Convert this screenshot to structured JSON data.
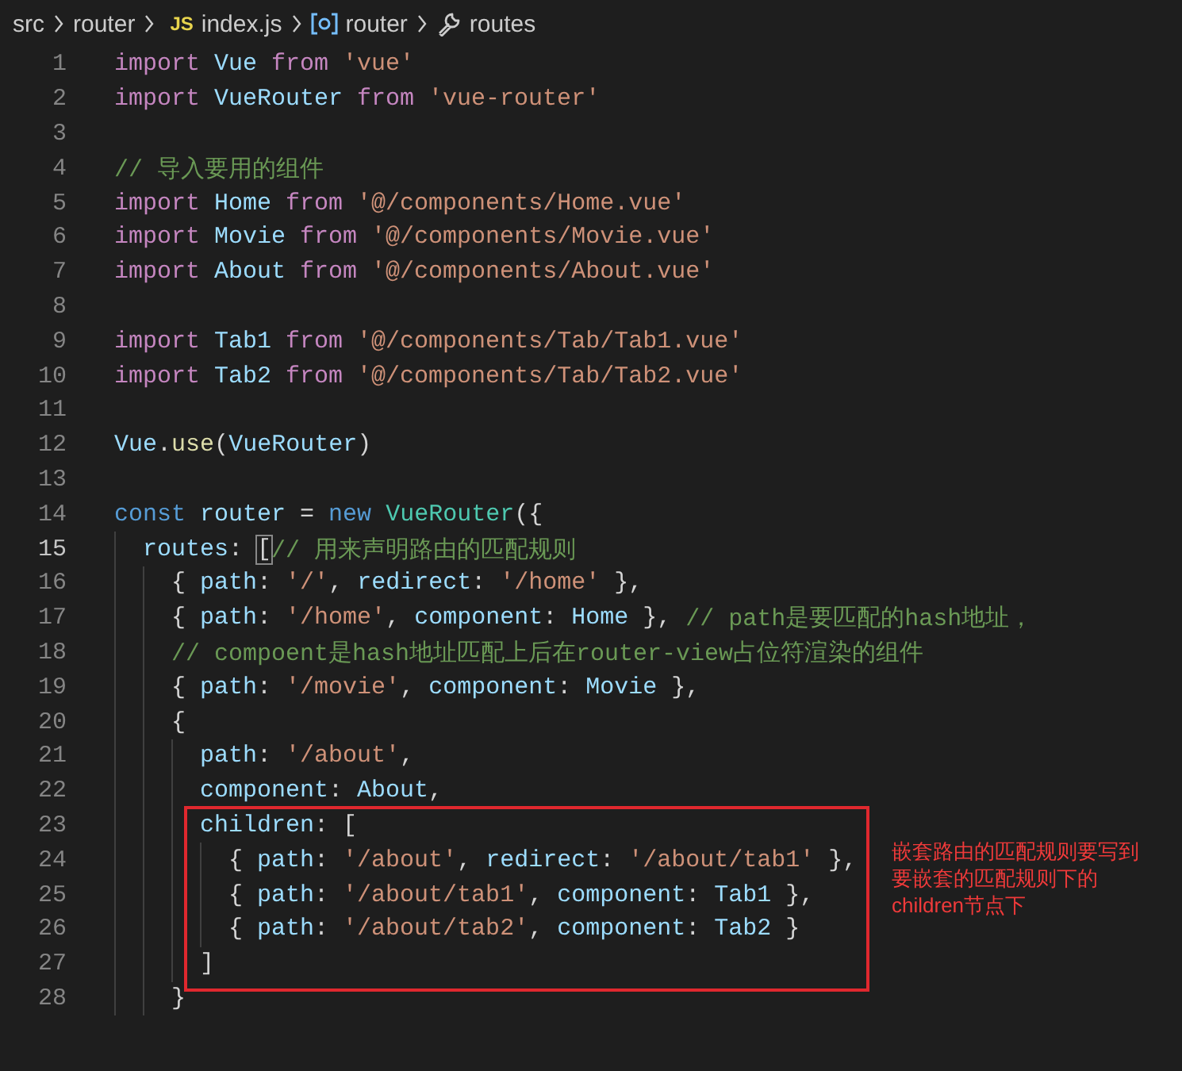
{
  "breadcrumb": [
    {
      "kind": "folder",
      "label": "src"
    },
    {
      "kind": "folder",
      "label": "router"
    },
    {
      "kind": "file",
      "label": "index.js",
      "badge": "JS"
    },
    {
      "kind": "variable",
      "label": "router"
    },
    {
      "kind": "property",
      "label": "routes"
    }
  ],
  "editor": {
    "lines": [
      {
        "number": "1",
        "active": false,
        "boxed": false,
        "tokens": [
          {
            "kind": "keyword",
            "text": "import"
          },
          {
            "kind": "variable",
            "text": " Vue"
          },
          {
            "kind": "keyword",
            "text": " from"
          },
          {
            "kind": "string",
            "text": " 'vue'"
          }
        ]
      },
      {
        "number": "2",
        "active": false,
        "boxed": false,
        "tokens": [
          {
            "kind": "keyword",
            "text": "import"
          },
          {
            "kind": "variable",
            "text": " VueRouter"
          },
          {
            "kind": "keyword",
            "text": " from"
          },
          {
            "kind": "string",
            "text": " 'vue-router'"
          }
        ]
      },
      {
        "number": "3",
        "active": false,
        "boxed": false
      },
      {
        "number": "4",
        "active": false,
        "boxed": false,
        "tokens": [
          {
            "kind": "comment",
            "text": "// 导入要用的组件"
          }
        ]
      },
      {
        "number": "5",
        "active": false,
        "boxed": false,
        "tokens": [
          {
            "kind": "keyword",
            "text": "import"
          },
          {
            "kind": "variable",
            "text": " Home"
          },
          {
            "kind": "keyword",
            "text": " from"
          },
          {
            "kind": "string",
            "text": " '@/components/Home.vue'"
          }
        ]
      },
      {
        "number": "6",
        "active": false,
        "boxed": false,
        "tokens": [
          {
            "kind": "keyword",
            "text": "import"
          },
          {
            "kind": "variable",
            "text": " Movie"
          },
          {
            "kind": "keyword",
            "text": " from"
          },
          {
            "kind": "string",
            "text": " '@/components/Movie.vue'"
          }
        ]
      },
      {
        "number": "7",
        "active": false,
        "boxed": false,
        "tokens": [
          {
            "kind": "keyword",
            "text": "import"
          },
          {
            "kind": "variable",
            "text": " About"
          },
          {
            "kind": "keyword",
            "text": " from"
          },
          {
            "kind": "string",
            "text": " '@/components/About.vue'"
          }
        ]
      },
      {
        "number": "8",
        "active": false,
        "boxed": false
      },
      {
        "number": "9",
        "active": false,
        "boxed": false,
        "tokens": [
          {
            "kind": "keyword",
            "text": "import"
          },
          {
            "kind": "variable",
            "text": " Tab1"
          },
          {
            "kind": "keyword",
            "text": " from"
          },
          {
            "kind": "string",
            "text": " '@/components/Tab/Tab1.vue'"
          }
        ]
      },
      {
        "number": "10",
        "active": false,
        "boxed": false,
        "tokens": [
          {
            "kind": "keyword",
            "text": "import"
          },
          {
            "kind": "variable",
            "text": " Tab2"
          },
          {
            "kind": "keyword",
            "text": " from"
          },
          {
            "kind": "string",
            "text": " '@/components/Tab/Tab2.vue'"
          }
        ]
      },
      {
        "number": "11",
        "active": false,
        "boxed": false
      },
      {
        "number": "12",
        "active": false,
        "boxed": false,
        "tokens": [
          {
            "kind": "variable",
            "text": "Vue"
          },
          {
            "kind": "plain",
            "text": "."
          },
          {
            "kind": "function",
            "text": "use"
          },
          {
            "kind": "plain",
            "text": "("
          },
          {
            "kind": "variable",
            "text": "VueRouter"
          },
          {
            "kind": "plain",
            "text": ")"
          }
        ]
      },
      {
        "number": "13",
        "active": false,
        "boxed": false
      },
      {
        "number": "14",
        "active": false,
        "boxed": false,
        "tokens": [
          {
            "kind": "storage",
            "text": "const"
          },
          {
            "kind": "variable",
            "text": " router"
          },
          {
            "kind": "plain",
            "text": " ="
          },
          {
            "kind": "storage",
            "text": " new"
          },
          {
            "kind": "class",
            "text": " VueRouter"
          },
          {
            "kind": "plain",
            "text": "({"
          }
        ],
        "children": [
          {
            "number": "15",
            "active": true,
            "boxed": false,
            "tokens": [
              {
                "kind": "variable",
                "text": "routes"
              },
              {
                "kind": "plain",
                "text": ": "
              },
              {
                "kind": "match",
                "text": "["
              },
              {
                "kind": "comment",
                "text": "// 用来声明路由的匹配规则"
              }
            ],
            "children": [
              {
                "number": "16",
                "active": false,
                "boxed": false,
                "tokens": [
                  {
                    "kind": "plain",
                    "text": "{ "
                  },
                  {
                    "kind": "variable",
                    "text": "path"
                  },
                  {
                    "kind": "plain",
                    "text": ": "
                  },
                  {
                    "kind": "string",
                    "text": "'/'"
                  },
                  {
                    "kind": "plain",
                    "text": ", "
                  },
                  {
                    "kind": "variable",
                    "text": "redirect"
                  },
                  {
                    "kind": "plain",
                    "text": ": "
                  },
                  {
                    "kind": "string",
                    "text": "'/home'"
                  },
                  {
                    "kind": "plain",
                    "text": " },"
                  }
                ]
              },
              {
                "number": "17",
                "active": false,
                "boxed": false,
                "tokens": [
                  {
                    "kind": "plain",
                    "text": "{ "
                  },
                  {
                    "kind": "variable",
                    "text": "path"
                  },
                  {
                    "kind": "plain",
                    "text": ": "
                  },
                  {
                    "kind": "string",
                    "text": "'/home'"
                  },
                  {
                    "kind": "plain",
                    "text": ", "
                  },
                  {
                    "kind": "variable",
                    "text": "component"
                  },
                  {
                    "kind": "plain",
                    "text": ": "
                  },
                  {
                    "kind": "variable",
                    "text": "Home"
                  },
                  {
                    "kind": "plain",
                    "text": " }, "
                  },
                  {
                    "kind": "comment",
                    "text": "// path是要匹配的hash地址，"
                  }
                ]
              },
              {
                "number": "18",
                "active": false,
                "boxed": false,
                "tokens": [
                  {
                    "kind": "comment",
                    "text": "// compoent是hash地址匹配上后在router-view占位符渲染的组件"
                  }
                ]
              },
              {
                "number": "19",
                "active": false,
                "boxed": false,
                "tokens": [
                  {
                    "kind": "plain",
                    "text": "{ "
                  },
                  {
                    "kind": "variable",
                    "text": "path"
                  },
                  {
                    "kind": "plain",
                    "text": ": "
                  },
                  {
                    "kind": "string",
                    "text": "'/movie'"
                  },
                  {
                    "kind": "plain",
                    "text": ", "
                  },
                  {
                    "kind": "variable",
                    "text": "component"
                  },
                  {
                    "kind": "plain",
                    "text": ": "
                  },
                  {
                    "kind": "variable",
                    "text": "Movie"
                  },
                  {
                    "kind": "plain",
                    "text": " },"
                  }
                ]
              },
              {
                "number": "20",
                "active": false,
                "boxed": false,
                "tokens": [
                  {
                    "kind": "plain",
                    "text": "{"
                  }
                ],
                "children": [
                  {
                    "number": "21",
                    "active": false,
                    "boxed": false,
                    "tokens": [
                      {
                        "kind": "variable",
                        "text": "path"
                      },
                      {
                        "kind": "plain",
                        "text": ": "
                      },
                      {
                        "kind": "string",
                        "text": "'/about'"
                      },
                      {
                        "kind": "plain",
                        "text": ","
                      }
                    ]
                  },
                  {
                    "number": "22",
                    "active": false,
                    "boxed": false,
                    "tokens": [
                      {
                        "kind": "variable",
                        "text": "component"
                      },
                      {
                        "kind": "plain",
                        "text": ": "
                      },
                      {
                        "kind": "variable",
                        "text": "About"
                      },
                      {
                        "kind": "plain",
                        "text": ","
                      }
                    ]
                  },
                  {
                    "number": "23",
                    "active": false,
                    "boxed": true,
                    "tokens": [
                      {
                        "kind": "variable",
                        "text": "children"
                      },
                      {
                        "kind": "plain",
                        "text": ": ["
                      }
                    ],
                    "children": [
                      {
                        "number": "24",
                        "active": false,
                        "boxed": true,
                        "tokens": [
                          {
                            "kind": "plain",
                            "text": "{ "
                          },
                          {
                            "kind": "variable",
                            "text": "path"
                          },
                          {
                            "kind": "plain",
                            "text": ": "
                          },
                          {
                            "kind": "string",
                            "text": "'/about'"
                          },
                          {
                            "kind": "plain",
                            "text": ", "
                          },
                          {
                            "kind": "variable",
                            "text": "redirect"
                          },
                          {
                            "kind": "plain",
                            "text": ": "
                          },
                          {
                            "kind": "string",
                            "text": "'/about/tab1'"
                          },
                          {
                            "kind": "plain",
                            "text": " },"
                          }
                        ]
                      },
                      {
                        "number": "25",
                        "active": false,
                        "boxed": true,
                        "tokens": [
                          {
                            "kind": "plain",
                            "text": "{ "
                          },
                          {
                            "kind": "variable",
                            "text": "path"
                          },
                          {
                            "kind": "plain",
                            "text": ": "
                          },
                          {
                            "kind": "string",
                            "text": "'/about/tab1'"
                          },
                          {
                            "kind": "plain",
                            "text": ", "
                          },
                          {
                            "kind": "variable",
                            "text": "component"
                          },
                          {
                            "kind": "plain",
                            "text": ": "
                          },
                          {
                            "kind": "variable",
                            "text": "Tab1"
                          },
                          {
                            "kind": "plain",
                            "text": " },"
                          }
                        ]
                      },
                      {
                        "number": "26",
                        "active": false,
                        "boxed": true,
                        "tokens": [
                          {
                            "kind": "plain",
                            "text": "{ "
                          },
                          {
                            "kind": "variable",
                            "text": "path"
                          },
                          {
                            "kind": "plain",
                            "text": ": "
                          },
                          {
                            "kind": "string",
                            "text": "'/about/tab2'"
                          },
                          {
                            "kind": "plain",
                            "text": ", "
                          },
                          {
                            "kind": "variable",
                            "text": "component"
                          },
                          {
                            "kind": "plain",
                            "text": ": "
                          },
                          {
                            "kind": "variable",
                            "text": "Tab2"
                          },
                          {
                            "kind": "plain",
                            "text": " }"
                          }
                        ]
                      }
                    ]
                  },
                  {
                    "number": "27",
                    "active": false,
                    "boxed": true,
                    "tokens": [
                      {
                        "kind": "plain",
                        "text": "]"
                      }
                    ]
                  }
                ]
              },
              {
                "number": "28",
                "active": false,
                "boxed": false,
                "tokens": [
                  {
                    "kind": "plain",
                    "text": "}"
                  }
                ]
              }
            ]
          }
        ]
      }
    ],
    "annotation": {
      "note": "嵌套路由的匹配规则要写到要嵌套的匹配规则下的children节点下"
    }
  }
}
